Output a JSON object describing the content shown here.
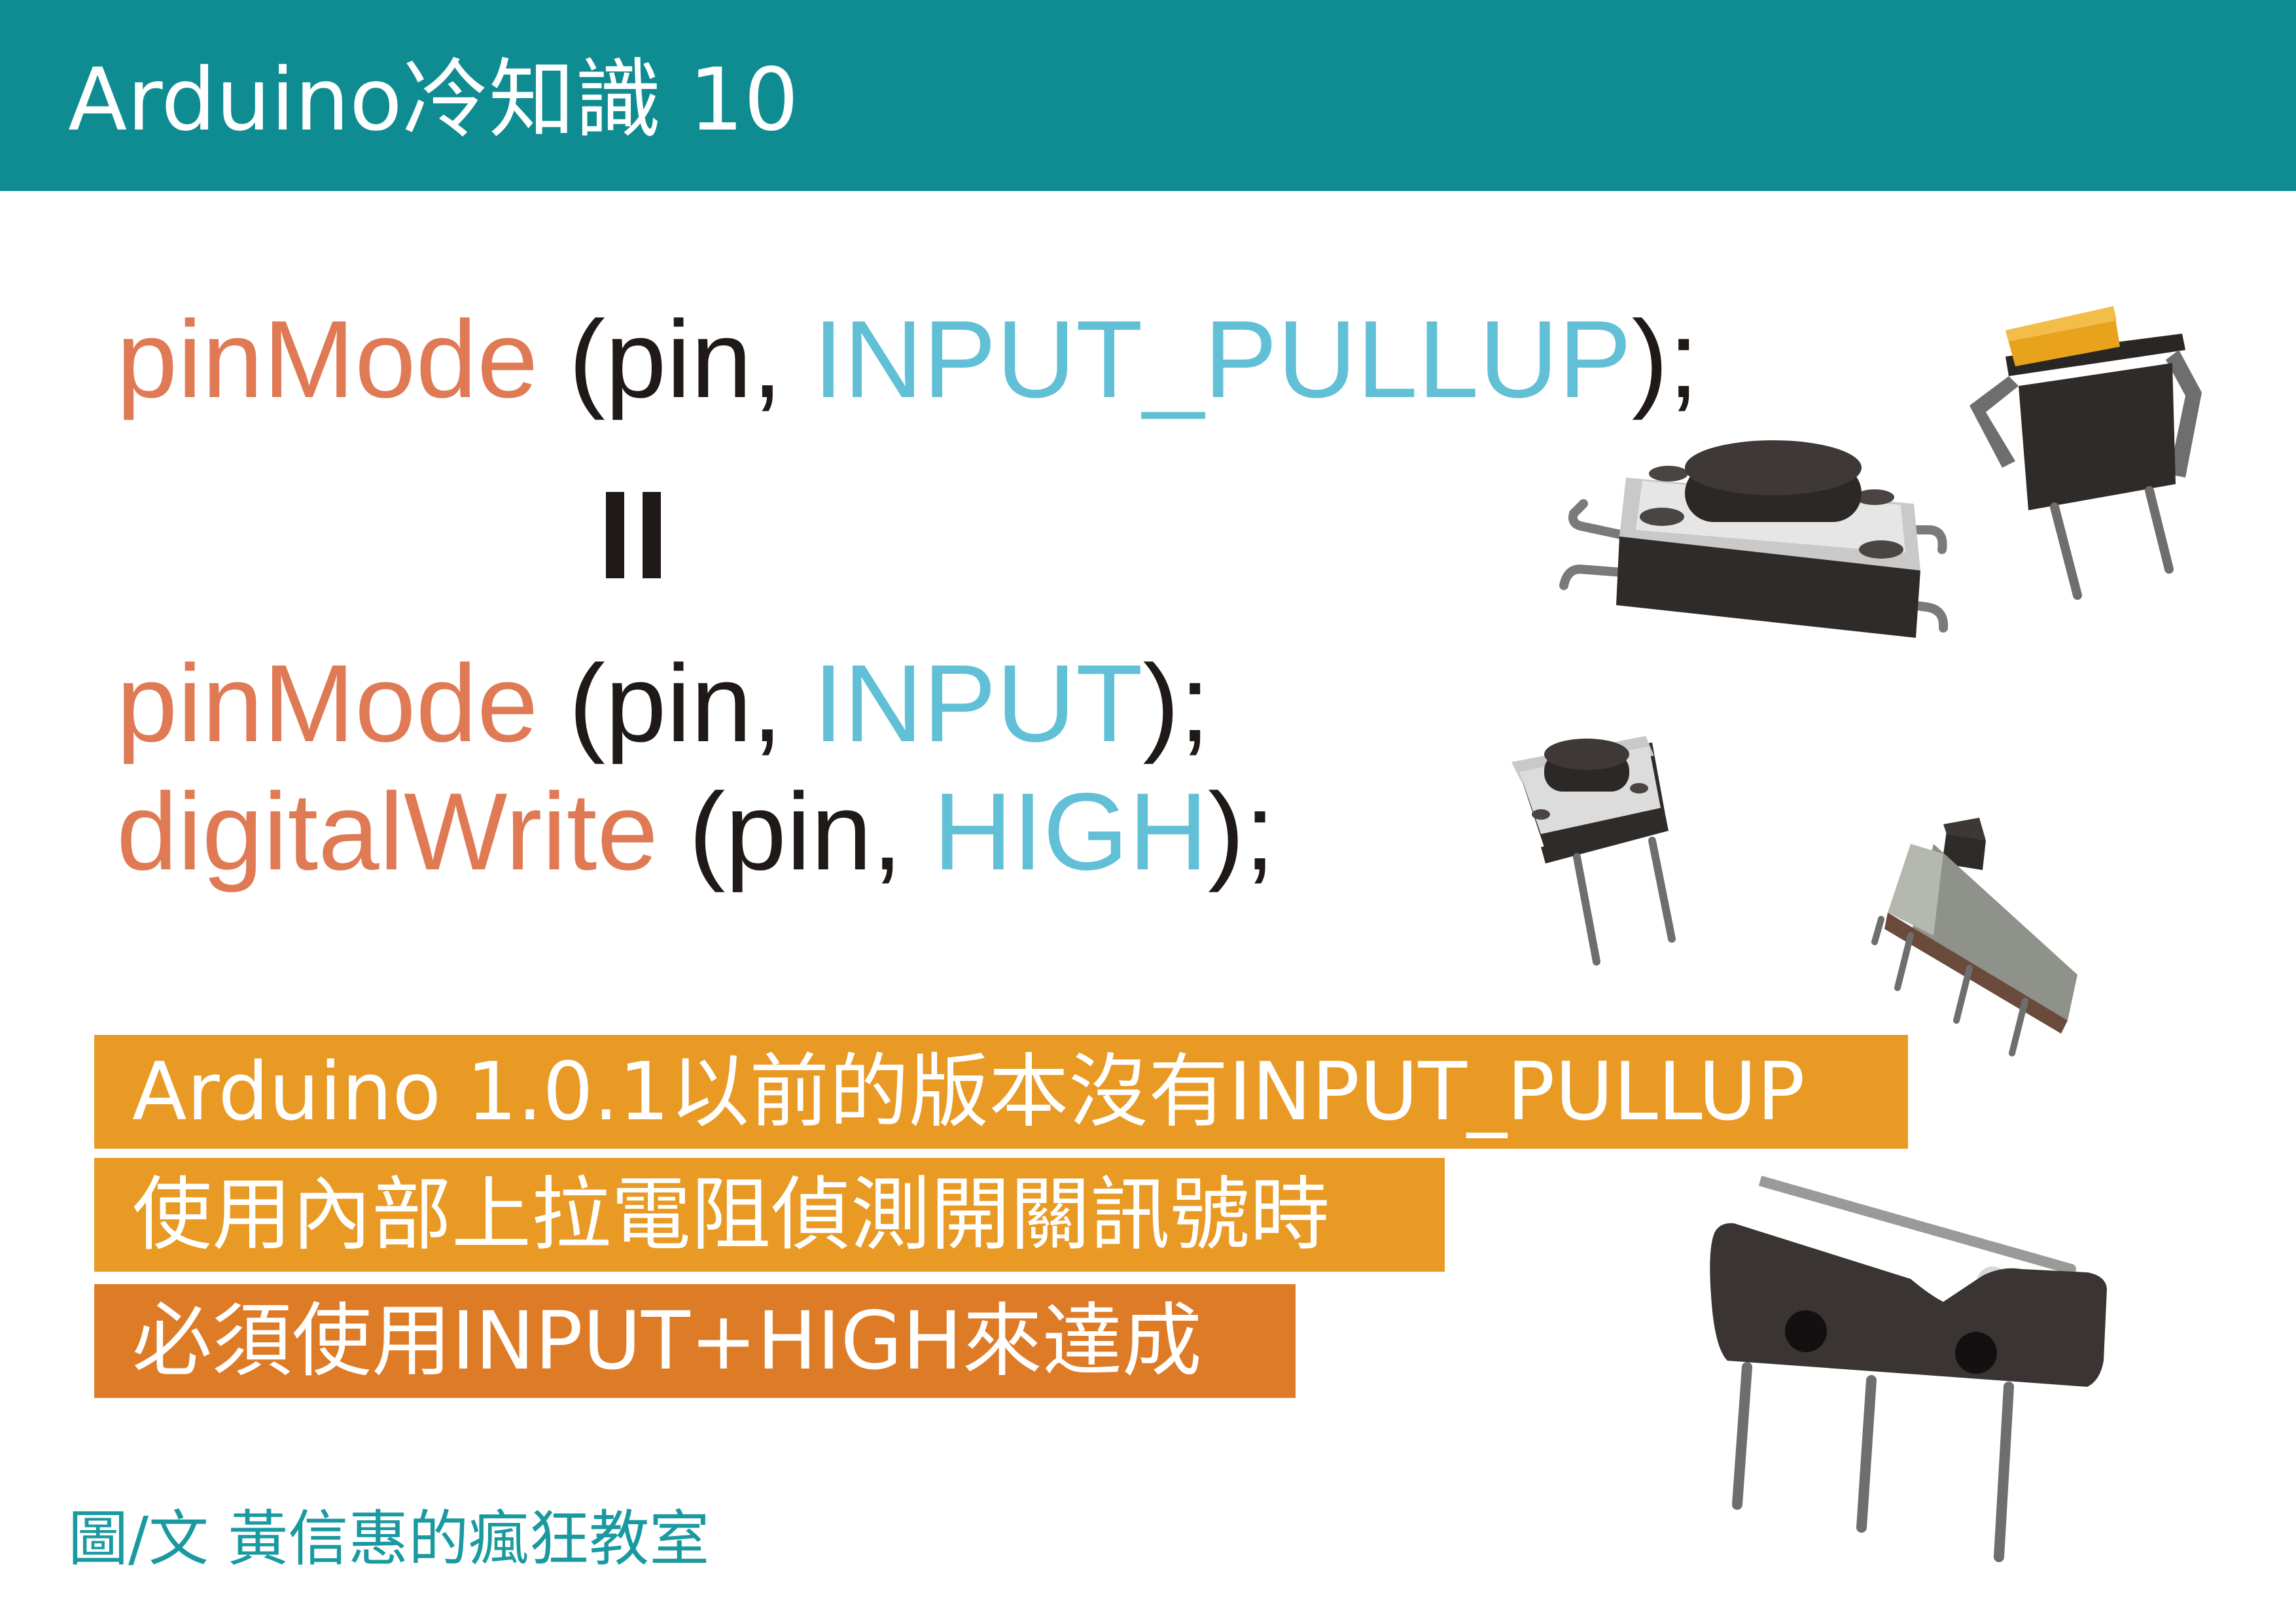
{
  "header": {
    "title": "Arduino冷知識 10"
  },
  "code": {
    "line1": {
      "fn": "pinMode",
      "open": " (pin, ",
      "const": "INPUT_PULLUP",
      "close": ");"
    },
    "line2": {
      "fn": "pinMode",
      "open": " (pin, ",
      "const": "INPUT",
      "close": ");"
    },
    "line3": {
      "fn": "digitalWrite",
      "open": " (pin, ",
      "const": "HIGH",
      "close": ");"
    }
  },
  "notes": [
    "Arduino 1.0.1以前的版本沒有INPUT_PULLUP",
    "使用內部上拉電阻偵測開關訊號時",
    "必須使用INPUT+HIGH來達成"
  ],
  "credit": "圖/文  黃信惠的瘋狂教室",
  "colors": {
    "header_bg": "#0f8c92",
    "function": "#df7a55",
    "constant": "#62c0d6",
    "note_bg": "#e89a25",
    "note_bg_dark": "#de7b27",
    "credit": "#1a9aa0"
  }
}
